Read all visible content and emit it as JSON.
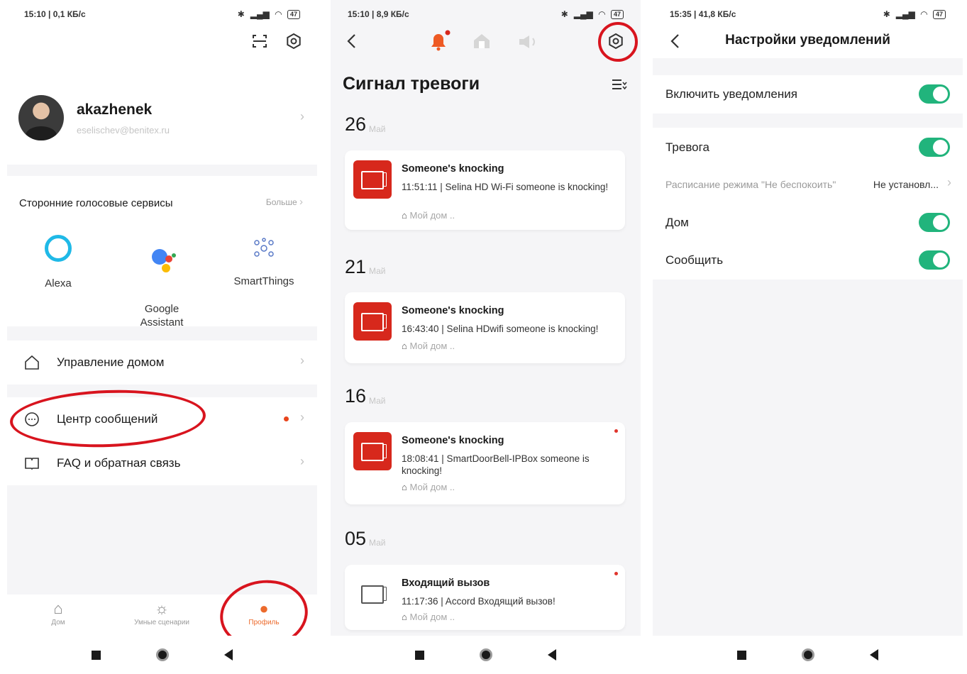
{
  "phone1": {
    "status": {
      "time": "15:10 | 0,1 КБ/с",
      "battery": "47"
    },
    "user": {
      "name": "akazhenek",
      "email": "eselischev@benitex.ru"
    },
    "voice": {
      "title": "Сторонние голосовые сервисы",
      "more": "Больше",
      "services": [
        {
          "label": "Alexa"
        },
        {
          "label": "Google\nAssistant"
        },
        {
          "label": "SmartThings"
        }
      ]
    },
    "menu": {
      "home_control": "Управление домом",
      "message_center": "Центр сообщений",
      "faq": "FAQ и обратная связь"
    },
    "tabs": {
      "home": "Дом",
      "scenes": "Умные сценарии",
      "profile": "Профиль"
    },
    "colors": {
      "accent": "#ec6a2c",
      "annotation": "#d8141e"
    }
  },
  "phone2": {
    "status": {
      "time": "15:10 | 8,9 КБ/с",
      "battery": "47"
    },
    "title": "Сигнал тревоги",
    "groups": [
      {
        "day": "26",
        "month": "Май",
        "title": "Someone's knocking",
        "message": "11:51:11 |  Selina HD Wi-Fi someone is knocking!",
        "home": "Мой дом ..",
        "unread": false
      },
      {
        "day": "21",
        "month": "Май",
        "title": "Someone's knocking",
        "message": "16:43:40 |  Selina HDwifi someone is knocking!",
        "home": "Мой дом ..",
        "unread": false
      },
      {
        "day": "16",
        "month": "Май",
        "title": "Someone's knocking",
        "message": "18:08:41 | SmartDoorBell-IPBox someone is knocking!",
        "home": "Мой дом ..",
        "unread": true
      },
      {
        "day": "05",
        "month": "Май",
        "title": "Входящий вызов",
        "message": "11:17:36 | Accord Входящий вызов!",
        "home": "Мой дом ..",
        "unread": true
      }
    ]
  },
  "phone3": {
    "status": {
      "time": "15:35 | 41,8 КБ/с",
      "battery": "47"
    },
    "title": "Настройки уведомлений",
    "enable": {
      "label": "Включить уведомления",
      "on": true
    },
    "alarm": {
      "label": "Тревога",
      "on": true
    },
    "schedule": {
      "label": "Расписание режима \"Не беспокоить\"",
      "value": "Не установл..."
    },
    "home": {
      "label": "Дом",
      "on": true
    },
    "notify": {
      "label": "Сообщить",
      "on": true
    },
    "colors": {
      "toggle_on": "#21b47c"
    }
  }
}
